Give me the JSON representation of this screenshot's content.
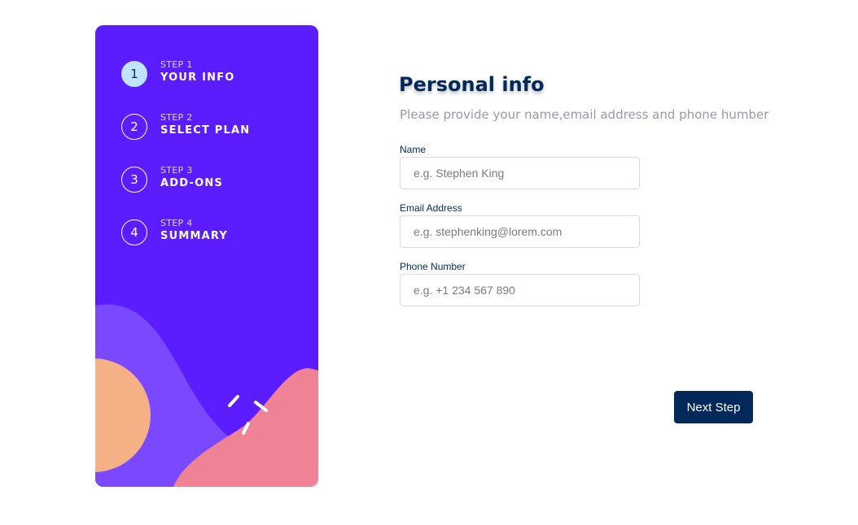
{
  "sidebar": {
    "steps": [
      {
        "number": "1",
        "kicker": "STEP 1",
        "title": "YOUR INFO",
        "active": true
      },
      {
        "number": "2",
        "kicker": "STEP 2",
        "title": "SELECT PLAN",
        "active": false
      },
      {
        "number": "3",
        "kicker": "STEP 3",
        "title": "ADD-ONS",
        "active": false
      },
      {
        "number": "4",
        "kicker": "STEP 4",
        "title": "SUMMARY",
        "active": false
      }
    ]
  },
  "main": {
    "title": "Personal info",
    "subtitle": "Please provide your name,email address and phone humber",
    "fields": {
      "name": {
        "label": "Name",
        "value": "",
        "placeholder": "e.g. Stephen King"
      },
      "email": {
        "label": "Email Address",
        "value": "",
        "placeholder": "e.g. stephenking@lorem.com"
      },
      "phone": {
        "label": "Phone Number",
        "value": "",
        "placeholder": "e.g. +1 234 567 890"
      }
    },
    "next_label": "Next Step"
  },
  "colors": {
    "sidebar_bg": "#5b1cff",
    "active_step_bg": "#bfe2fd",
    "title": "#02295a",
    "subtitle": "#9699ab",
    "button_bg": "#02295a",
    "shape_purple": "#7a49ff",
    "shape_orange": "#f6b086",
    "shape_pink": "#ef8295"
  }
}
